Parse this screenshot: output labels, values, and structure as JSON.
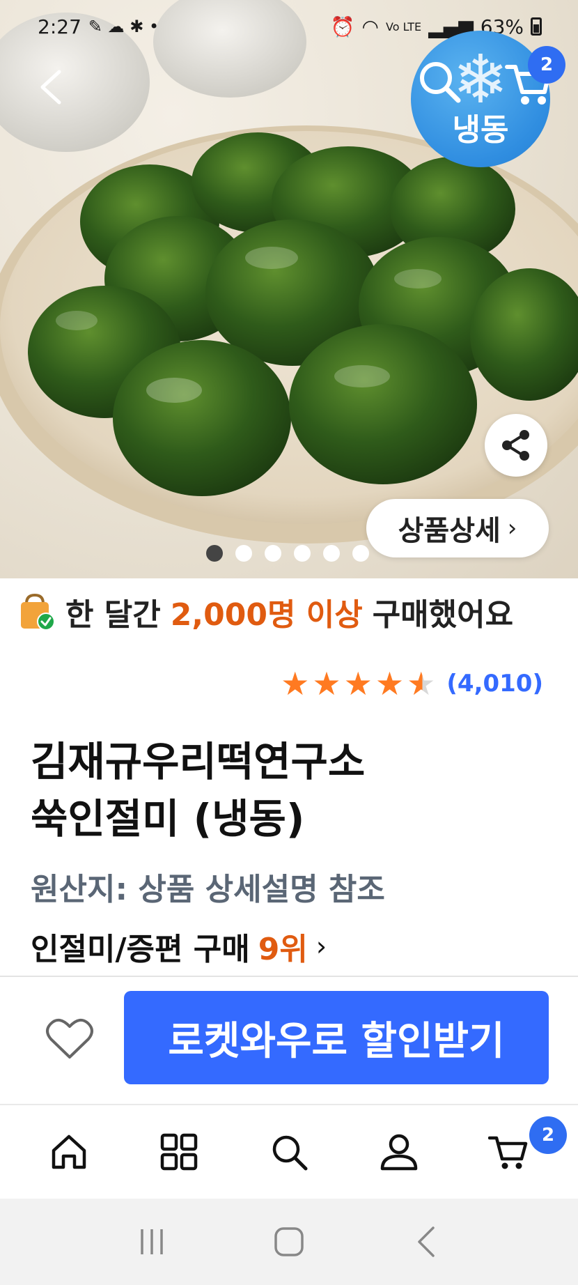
{
  "status_bar": {
    "time": "2:27",
    "network_label": "Vo LTE",
    "battery_text": "63%"
  },
  "header": {
    "frozen_badge_label": "냉동",
    "cart_count": "2"
  },
  "gallery": {
    "detail_button_label": "상품상세",
    "image_count": 6,
    "active_index": 0
  },
  "purchase_banner": {
    "prefix": "한 달간",
    "highlight": "2,000명 이상",
    "suffix": "구매했어요"
  },
  "rating": {
    "stars": 4.5,
    "count": "(4,010)"
  },
  "product": {
    "title_line1": "김재규우리떡연구소",
    "title_line2": "쑥인절미 (냉동)",
    "origin": "원산지: 상품 상세설명 참조",
    "rank_prefix": "인절미/증편 구매",
    "rank_number": "9위"
  },
  "actions": {
    "wow_button_label": "로켓와우로 할인받기"
  },
  "bottom_nav": {
    "cart_count": "2",
    "items": [
      "home-icon",
      "category-icon",
      "search-icon",
      "profile-icon",
      "cart-icon"
    ]
  },
  "colors": {
    "accent_blue": "#346aff",
    "highlight_orange": "#e05b10",
    "star_orange": "#ff7a21",
    "frozen_blue": "#2f8de0"
  }
}
